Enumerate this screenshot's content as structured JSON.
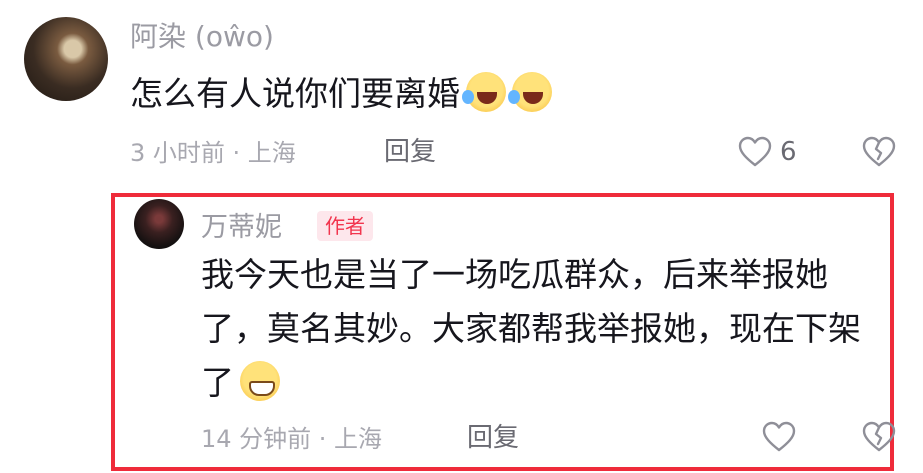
{
  "comments": [
    {
      "username": "阿染 (oŵo)",
      "text": "怎么有人说你们要离婚",
      "emojis": [
        "tears-of-joy-emoji",
        "tears-of-joy-emoji"
      ],
      "time_location": "3 小时前 · 上海",
      "reply_label": "回复",
      "like_count": "6"
    }
  ],
  "reply": {
    "username": "万蒂妮",
    "badge": "作者",
    "text": "我今天也是当了一场吃瓜群众，后来举报她了，莫名其妙。大家都帮我举报她，现在下架了",
    "emojis": [
      "grinning-emoji"
    ],
    "time_location": "14 分钟前 · 上海",
    "reply_label": "回复"
  },
  "colors": {
    "highlight_border": "#ef2b3a",
    "author_badge_bg": "#fde7ec",
    "author_badge_text": "#f2354e",
    "meta_text": "#a8a8b0"
  }
}
